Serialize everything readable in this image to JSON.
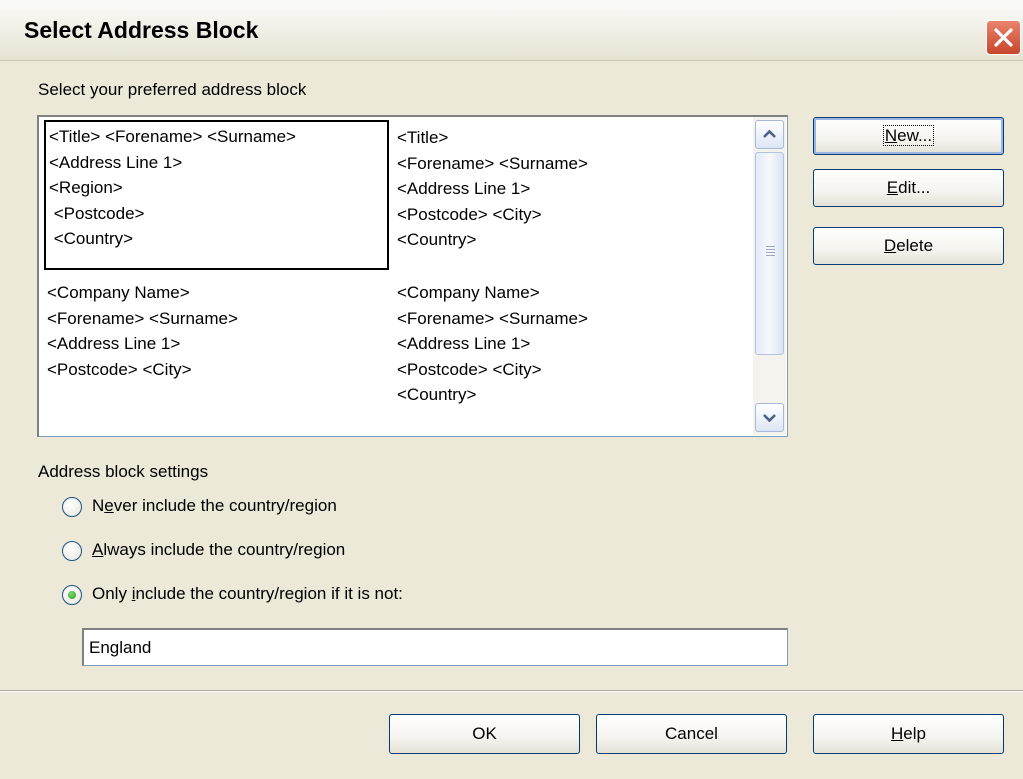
{
  "window": {
    "title": "Select Address Block"
  },
  "list_section": {
    "label": "Select your preferred address block",
    "blocks": [
      {
        "lines": [
          "<Title> <Forename> <Surname>",
          "<Address Line 1>",
          "<Region>",
          " <Postcode>",
          " <Country>"
        ],
        "selected": true
      },
      {
        "lines": [
          "<Title>",
          "<Forename> <Surname>",
          "<Address Line 1>",
          "<Postcode> <City>",
          "<Country>"
        ],
        "selected": false
      },
      {
        "lines": [
          "<Company Name>",
          "<Forename> <Surname>",
          "<Address Line 1>",
          "<Postcode> <City>"
        ],
        "selected": false
      },
      {
        "lines": [
          "<Company Name>",
          "<Forename> <Surname>",
          "<Address Line 1>",
          "<Postcode> <City>",
          "<Country>"
        ],
        "selected": false
      }
    ]
  },
  "side_buttons": {
    "new": {
      "pre": "",
      "key": "N",
      "post": "ew..."
    },
    "edit": {
      "pre": "",
      "key": "E",
      "post": "dit..."
    },
    "delete": {
      "pre": "",
      "key": "D",
      "post": "elete"
    }
  },
  "settings": {
    "label": "Address block settings",
    "options": [
      {
        "pre": "N",
        "key": "e",
        "post": "ver include the country/region",
        "checked": false
      },
      {
        "pre": "",
        "key": "A",
        "post": "lways include the country/region",
        "checked": false
      },
      {
        "pre": "Only ",
        "key": "i",
        "post": "nclude the country/region if it is not:",
        "checked": true
      }
    ],
    "country_value": "England"
  },
  "footer": {
    "ok": "OK",
    "cancel": "Cancel",
    "help": {
      "pre": "",
      "key": "H",
      "post": "elp"
    }
  },
  "colors": {
    "button_border": "#003c74",
    "dialog_bg": "#ece9d8",
    "close_red": "#c8452d"
  },
  "icons": {
    "close": "close-icon",
    "scroll_up": "chevron-up-icon",
    "scroll_down": "chevron-down-icon"
  }
}
